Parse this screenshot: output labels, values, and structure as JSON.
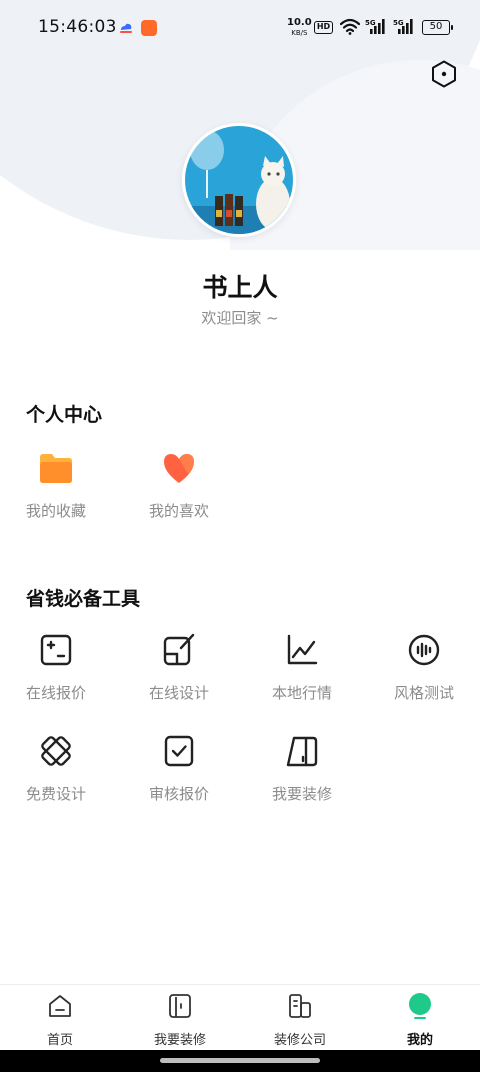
{
  "status_bar": {
    "time": "15:46:03",
    "net_speed_value": "10.0",
    "net_speed_unit": "KB/S",
    "hd_label": "HD",
    "signal1_label": "5G",
    "signal2_label": "5G",
    "battery": "50"
  },
  "profile": {
    "name": "书上人",
    "welcome": "欢迎回家 ~"
  },
  "personal_center": {
    "title": "个人中心",
    "items": [
      {
        "label": "我的收藏",
        "icon": "folder-icon"
      },
      {
        "label": "我的喜欢",
        "icon": "heart-icon"
      }
    ]
  },
  "tools": {
    "title": "省钱必备工具",
    "items": [
      {
        "label": "在线报价",
        "icon": "calculator-icon"
      },
      {
        "label": "在线设计",
        "icon": "design-icon"
      },
      {
        "label": "本地行情",
        "icon": "chart-icon"
      },
      {
        "label": "风格测试",
        "icon": "style-test-icon"
      },
      {
        "label": "免费设计",
        "icon": "ruler-icon"
      },
      {
        "label": "审核报价",
        "icon": "check-icon"
      },
      {
        "label": "我要装修",
        "icon": "renovate-icon"
      }
    ]
  },
  "bottom_nav": {
    "items": [
      {
        "label": "首页",
        "icon": "home-icon",
        "active": false
      },
      {
        "label": "我要装修",
        "icon": "door-icon",
        "active": false
      },
      {
        "label": "装修公司",
        "icon": "building-icon",
        "active": false
      },
      {
        "label": "我的",
        "icon": "profile-dot-icon",
        "active": true
      }
    ]
  },
  "colors": {
    "accent_green": "#1ec98a",
    "orange": "#ff8a2a",
    "heart": "#ff6240",
    "muted_text": "#8c8c8c"
  }
}
